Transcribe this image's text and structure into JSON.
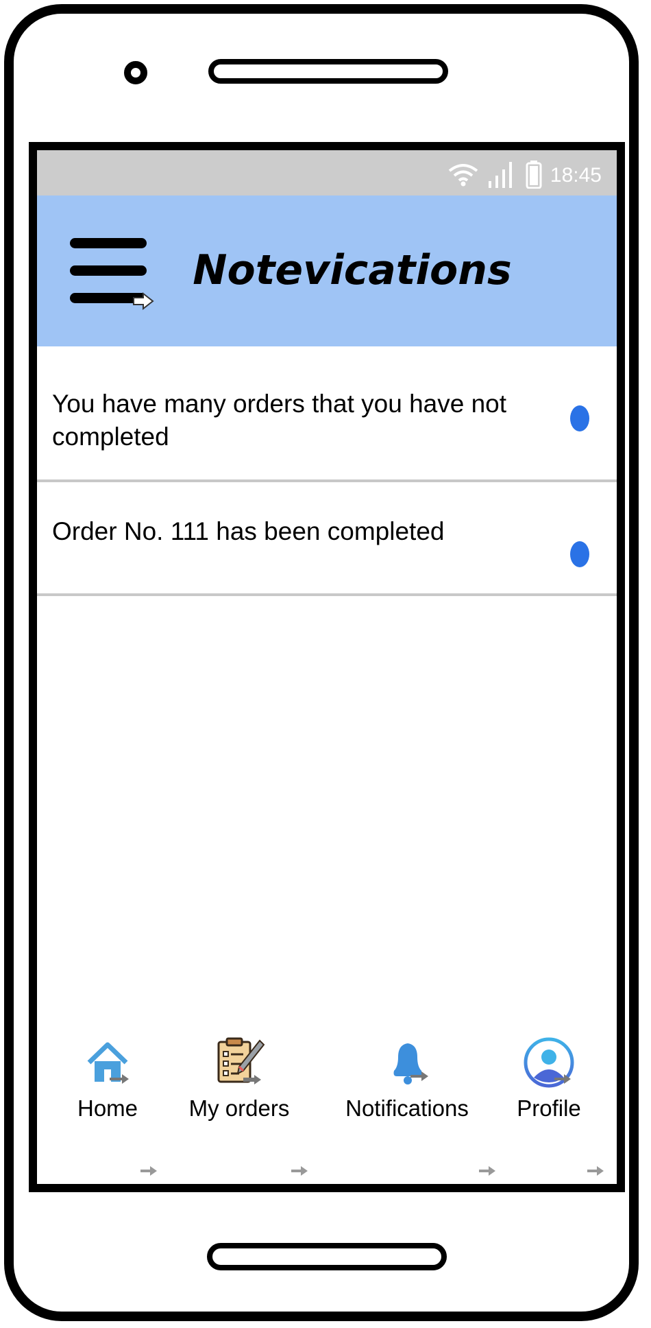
{
  "status_bar": {
    "time": "18:45",
    "icons": [
      "wifi-icon",
      "signal-icon",
      "battery-icon"
    ]
  },
  "header": {
    "title": "Notevications",
    "menu_icon": "hamburger-menu-icon",
    "background": "#9fc4f5"
  },
  "notifications": [
    {
      "text": "You have many orders that you have not completed",
      "unread": true
    },
    {
      "text": "Order No. 111 has been completed",
      "unread": true
    }
  ],
  "colors": {
    "unread_dot": "#2a72e6",
    "status_bar": "#cccccc",
    "divider": "#c8c8c8"
  },
  "bottom_nav": {
    "items": [
      {
        "label": "Home",
        "icon": "home-icon"
      },
      {
        "label": "My orders",
        "icon": "clipboard-icon"
      },
      {
        "label": "Notifications",
        "icon": "bell-icon"
      },
      {
        "label": "Profile",
        "icon": "profile-icon"
      }
    ]
  }
}
